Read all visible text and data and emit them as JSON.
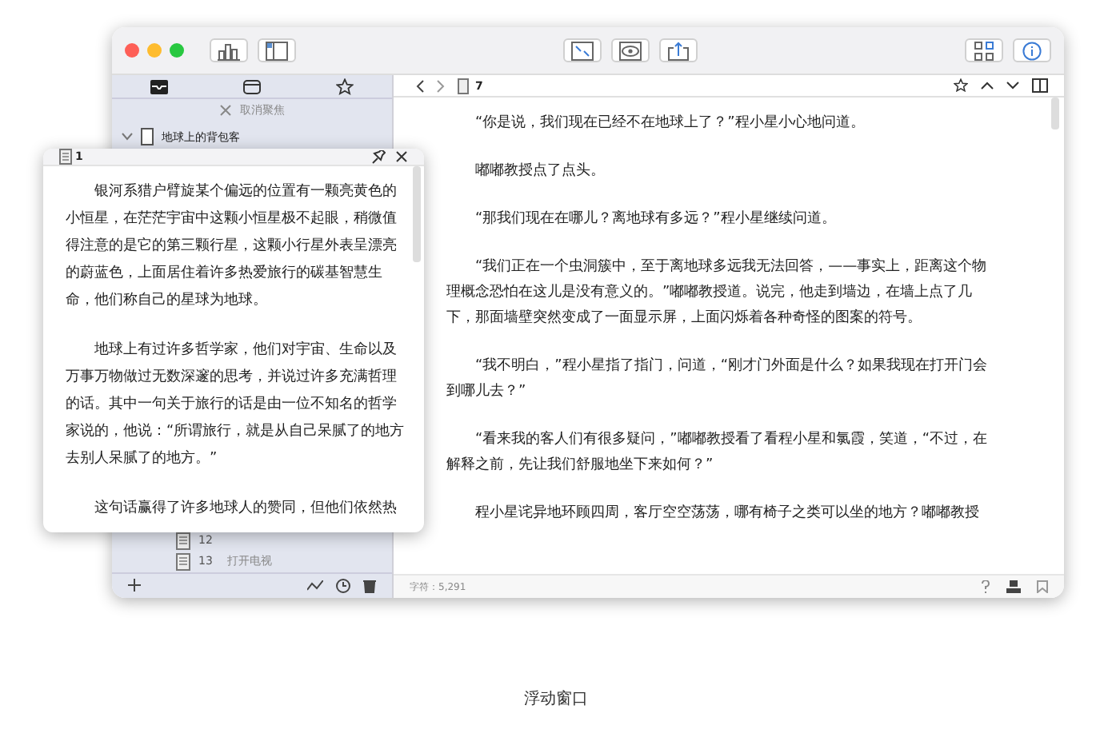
{
  "sidebar": {
    "unfocus_label": "取消聚焦",
    "tree": [
      {
        "title": "地球上的背包客",
        "expanded": true,
        "children": [
          {
            "number": "12"
          },
          {
            "number": "13",
            "title": "打开电视"
          }
        ]
      }
    ]
  },
  "editor": {
    "page_number": "7",
    "paragraphs": [
      "“你是说，我们现在已经不在地球上了？”程小星小心地问道。",
      "嘟嘟教授点了点头。",
      "“那我们现在在哪儿？离地球有多远？”程小星继续问道。",
      "“我们正在一个虫洞簇中，至于离地球多远我无法回答，——事实上，距离这个物理概念恐怕在这儿是没有意义的。”嘟嘟教授道。说完，他走到墙边，在墙上点了几下，那面墙壁突然变成了一面显示屏，上面闪烁着各种奇怪的图案的符号。",
      "“我不明白，”程小星指了指门，问道，“刚才门外面是什么？如果我现在打开门会到哪儿去？”",
      "“看来我的客人们有很多疑问，”嘟嘟教授看了看程小星和氯霞，笑道，“不过，在解释之前，先让我们舒服地坐下来如何？”",
      "程小星诧异地环顾四周，客厅空空荡荡，哪有椅子之类可以坐的地方？嘟嘟教授"
    ],
    "status": "字符：5,291"
  },
  "floating_panel": {
    "page_number": "1",
    "paragraphs": [
      "银河系猎户臂旋某个偏远的位置有一颗亮黄色的小恒星，在茫茫宇宙中这颗小恒星极不起眼，稍微值得注意的是它的第三颗行星，这颗小行星外表呈漂亮的蔚蓝色，上面居住着许多热爱旅行的碳基智慧生命，他们称自己的星球为地球。",
      "地球上有过许多哲学家，他们对宇宙、生命以及万事万物做过无数深邃的思考，并说过许多充满哲理的话。其中一句关于旅行的话是由一位不知名的哲学家说的，他说：“所谓旅行，就是从自己呆腻了的地方去别人呆腻了的地方。”",
      "这句话赢得了许多地球人的赞同，但他们依然热"
    ]
  },
  "caption": "浮动窗口"
}
